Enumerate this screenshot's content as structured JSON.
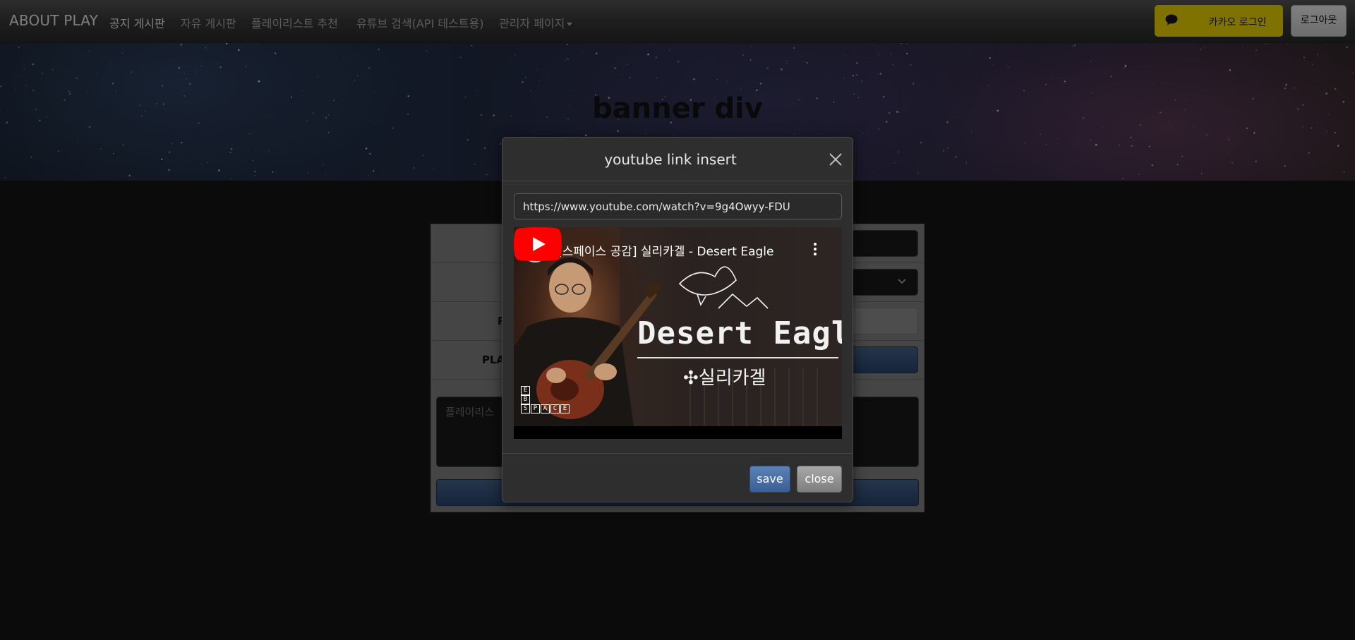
{
  "navbar": {
    "brand": "ABOUT PLAY",
    "items": [
      {
        "label": "공지 게시판"
      },
      {
        "label": "자유 게시판"
      },
      {
        "label": "플레이리스트 추천"
      },
      {
        "label": "유튜브 검색(API 테스트용)"
      },
      {
        "label": "관리자 페이지"
      }
    ],
    "kakao_login": "카카오 로그인",
    "logout": "로그아웃",
    "colors": {
      "kakao": "#FEE500"
    }
  },
  "banner": {
    "title": "banner div"
  },
  "form": {
    "rows": [
      {
        "label": ""
      },
      {
        "label": ""
      },
      {
        "label": "P"
      },
      {
        "label": "PLA"
      }
    ],
    "textarea_placeholder": "플레이리스"
  },
  "modal": {
    "title": "youtube link insert",
    "url_value": "https://www.youtube.com/watch?v=9g4Owyy-FDU",
    "video": {
      "title": "[스페이스 공감] 실리카겔 - Desert Eagle",
      "overlay_main": "Desert Eagle",
      "overlay_sub": "✣실리카겔",
      "ebs_letters": [
        "E",
        "B",
        "S",
        "P",
        "A",
        "C",
        "E"
      ]
    },
    "save_label": "save",
    "close_label": "close"
  }
}
